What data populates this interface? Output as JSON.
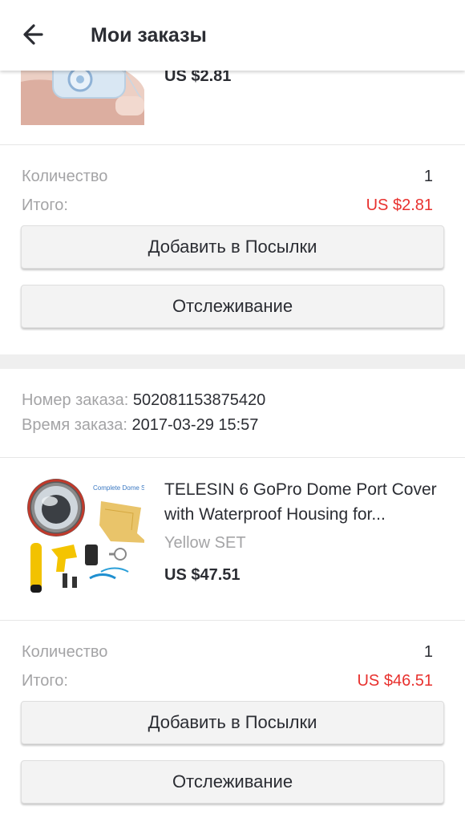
{
  "header": {
    "title": "Мои заказы",
    "back_icon": "arrow-left-icon"
  },
  "orders": [
    {
      "item": {
        "price": "US $2.81",
        "image": "product-photo-hand-holding-item"
      },
      "quantity_label": "Количество",
      "quantity": "1",
      "total_label": "Итого:",
      "total": "US $2.81",
      "add_button": "Добавить в Посылки",
      "track_button": "Отслеживание"
    },
    {
      "order_number_label": "Номер заказа:",
      "order_number": "502081153875420",
      "order_time_label": "Время заказа:",
      "order_time": "2017-03-29 15:57",
      "item": {
        "title_line1": "TELESIN 6 GoPro Dome Port Cover",
        "title_line2": "with Waterproof Housing for...",
        "variant": "Yellow SET",
        "price": "US $47.51",
        "image": "product-photo-dome-set",
        "image_caption": "Complete Dome Set"
      },
      "quantity_label": "Количество",
      "quantity": "1",
      "total_label": "Итого:",
      "total": "US $46.51",
      "add_button": "Добавить в Посылки",
      "track_button": "Отслеживание"
    }
  ],
  "colors": {
    "text": "#2b2d33",
    "muted": "#a4a4a6",
    "total_red": "#e8312e",
    "button_bg": "#f3f3f3",
    "page_bg": "#efefef"
  }
}
